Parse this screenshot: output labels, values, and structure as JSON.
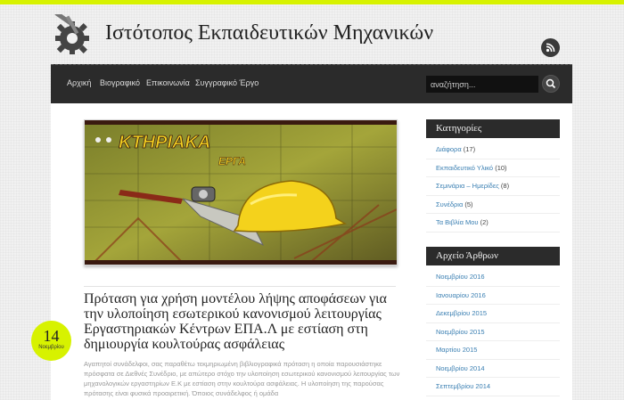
{
  "site": {
    "title": "Ιστότοπος Εκπαιδευτικών Μηχανικών"
  },
  "nav": {
    "items": [
      "Αρχική",
      "Βιογραφικό",
      "Επικοινωνία",
      "Συγγραφικό Έργο"
    ],
    "search_placeholder": "αναζήτηση..."
  },
  "post": {
    "image_text": "ΚΤΗΡΙΑΚΑ ΕΡΓΑ",
    "title": "Πρόταση για χρήση μοντέλου λήψης αποφάσεων για την υλοποίηση εσωτερικού κανονισμού λειτουργίας Εργαστηριακών Κέντρων ΕΠΑ.Λ με εστίαση στη δημιουργία κουλτούρας ασφάλειας",
    "excerpt": "Αγαπητοί συνάδελφοι, σας παραθέτω τεκμηριωμένη βιβλιογραφικά πρόταση η οποία παρουσιάστηκε πρόσφατα σε Διεθνές Συνέδριο, με απώτερο στόχο την υλοποίηση εσωτερικού κανονισμού λειτουργίας των μηχανολογικών εργαστηρίων Ε.Κ με εστίαση στην κουλτούρα ασφάλειας. Η υλοποίηση της παρούσας πρότασης είναι φυσικά προαιρετική. Όποιος συνάδελφος ή ομάδα",
    "date_day": "14",
    "date_month": "Νοεμβρίου"
  },
  "categories": {
    "title": "Κατηγορίες",
    "items": [
      {
        "label": "Διάφορα",
        "count": "(17)"
      },
      {
        "label": "Εκπαιδευτικό Υλικό",
        "count": "(10)"
      },
      {
        "label": "Σεμινάρια – Ημερίδες",
        "count": "(8)"
      },
      {
        "label": "Συνέδρια",
        "count": "(5)"
      },
      {
        "label": "Τα Βιβλία Μου",
        "count": "(2)"
      }
    ]
  },
  "archive": {
    "title": "Αρχείο Άρθρων",
    "items": [
      "Νοεμβρίου 2016",
      "Ιανουαρίου 2016",
      "Δεκεμβρίου 2015",
      "Νοεμβρίου 2015",
      "Μαρτίου 2015",
      "Νοεμβρίου 2014",
      "Σεπτεμβρίου 2014"
    ]
  },
  "colors": {
    "accent": "#d7f200",
    "nav_bg": "#2b2b2b",
    "link": "#3a7fb2"
  },
  "icons": {
    "logo": "gear-tools-icon",
    "rss": "rss-icon",
    "search": "search-icon"
  }
}
